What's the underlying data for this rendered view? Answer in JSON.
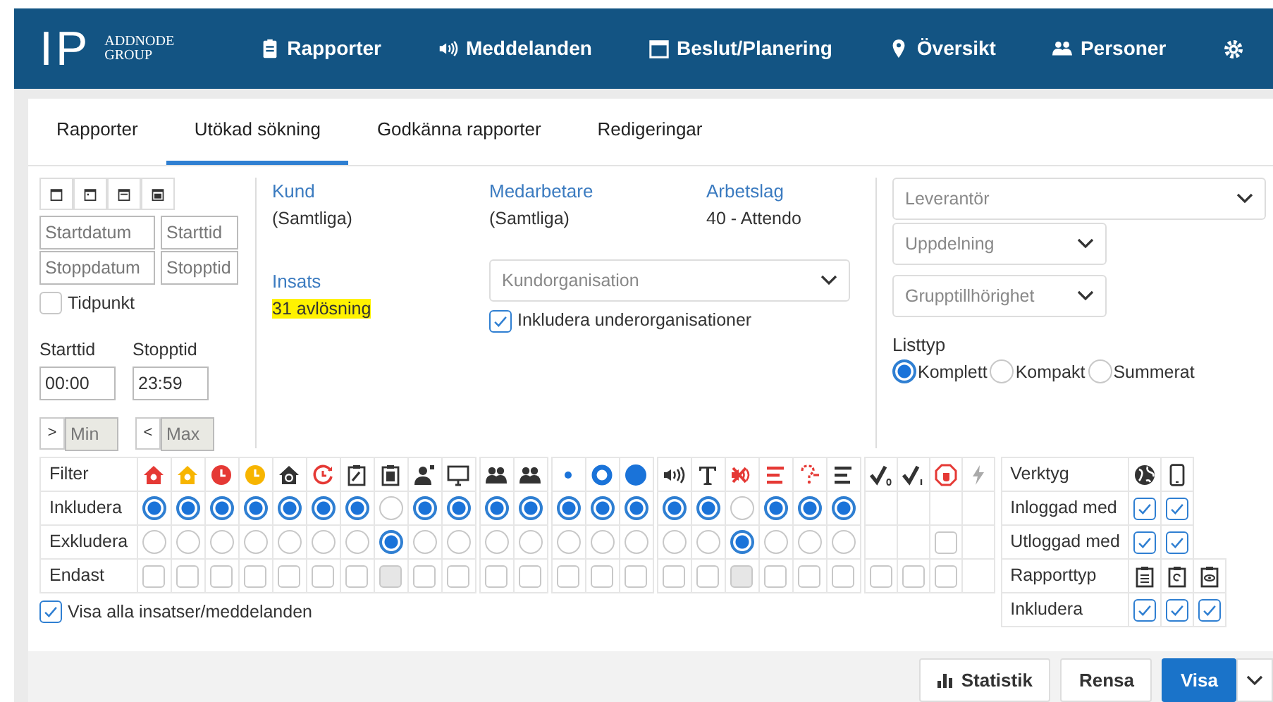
{
  "navbar": {
    "logo_mark": "IP",
    "logo_lines": [
      "ADDNODE",
      "GROUP"
    ],
    "items": [
      {
        "label": "Rapporter"
      },
      {
        "label": "Meddelanden"
      },
      {
        "label": "Beslut/Planering"
      },
      {
        "label": "Översikt"
      },
      {
        "label": "Personer"
      }
    ]
  },
  "tabs": [
    {
      "label": "Rapporter",
      "selected": false
    },
    {
      "label": "Utökad sökning",
      "selected": true
    },
    {
      "label": "Godkänna rapporter",
      "selected": false
    },
    {
      "label": "Redigeringar",
      "selected": false
    }
  ],
  "period": {
    "start_date": {
      "placeholder": "Startdatum"
    },
    "start_time": {
      "placeholder": "Starttid"
    },
    "stop_date": {
      "placeholder": "Stoppdatum"
    },
    "stop_time": {
      "placeholder": "Stopptid"
    },
    "tidpunkt": {
      "label": "Tidpunkt",
      "checked": false
    },
    "time_from": {
      "label": "Starttid",
      "value": "00:00"
    },
    "time_to": {
      "label": "Stopptid",
      "value": "23:59"
    },
    "min": {
      "prefix": ">",
      "placeholder": "Min",
      "disabled": true
    },
    "max": {
      "prefix": "<",
      "placeholder": "Max",
      "disabled": true
    }
  },
  "criteria": [
    {
      "label": "Kund",
      "value": "(Samtliga)"
    },
    {
      "label": "Medarbetare",
      "value": "(Samtliga)"
    },
    {
      "label": "Arbetslag",
      "value": "40 - Attendo"
    }
  ],
  "insats": {
    "label": "Insats",
    "value": "31 avlösning",
    "highlighted": true
  },
  "kundorganisation": {
    "placeholder": "Kundorganisation"
  },
  "include_sub": {
    "label": "Inkludera underorganisationer",
    "checked": true
  },
  "selects": [
    {
      "placeholder": "Leverantör",
      "wide": true
    },
    {
      "placeholder": "Uppdelning",
      "wide": false
    },
    {
      "placeholder": "Grupptillhörighet",
      "wide": false
    }
  ],
  "listtyp": {
    "label": "Listtyp",
    "options": [
      {
        "label": "Komplett",
        "selected": true
      },
      {
        "label": "Kompakt",
        "selected": false
      },
      {
        "label": "Summerat",
        "selected": false
      }
    ]
  },
  "filter": {
    "row_labels": [
      "Filter",
      "Inkludera",
      "Exkludera",
      "Endast"
    ],
    "columns": [
      {
        "group_start": false,
        "cells": [
          {
            "kind": "radio",
            "selected": true
          },
          {
            "kind": "radio",
            "selected": false
          },
          {
            "kind": "checkbox",
            "checked": false,
            "disabled": false
          }
        ]
      },
      {
        "group_start": false,
        "cells": [
          {
            "kind": "radio",
            "selected": true
          },
          {
            "kind": "radio",
            "selected": false
          },
          {
            "kind": "checkbox",
            "checked": false,
            "disabled": false
          }
        ]
      },
      {
        "group_start": false,
        "cells": [
          {
            "kind": "radio",
            "selected": true
          },
          {
            "kind": "radio",
            "selected": false
          },
          {
            "kind": "checkbox",
            "checked": false,
            "disabled": false
          }
        ]
      },
      {
        "group_start": false,
        "cells": [
          {
            "kind": "radio",
            "selected": true
          },
          {
            "kind": "radio",
            "selected": false
          },
          {
            "kind": "checkbox",
            "checked": false,
            "disabled": false
          }
        ]
      },
      {
        "group_start": false,
        "cells": [
          {
            "kind": "radio",
            "selected": true
          },
          {
            "kind": "radio",
            "selected": false
          },
          {
            "kind": "checkbox",
            "checked": false,
            "disabled": false
          }
        ]
      },
      {
        "group_start": false,
        "cells": [
          {
            "kind": "radio",
            "selected": true
          },
          {
            "kind": "radio",
            "selected": false
          },
          {
            "kind": "checkbox",
            "checked": false,
            "disabled": false
          }
        ]
      },
      {
        "group_start": false,
        "cells": [
          {
            "kind": "radio",
            "selected": true
          },
          {
            "kind": "radio",
            "selected": false
          },
          {
            "kind": "checkbox",
            "checked": false,
            "disabled": false
          }
        ]
      },
      {
        "group_start": false,
        "cells": [
          {
            "kind": "radio",
            "selected": false
          },
          {
            "kind": "radio",
            "selected": true
          },
          {
            "kind": "checkbox",
            "checked": false,
            "disabled": true
          }
        ]
      },
      {
        "group_start": false,
        "cells": [
          {
            "kind": "radio",
            "selected": true
          },
          {
            "kind": "radio",
            "selected": false
          },
          {
            "kind": "checkbox",
            "checked": false,
            "disabled": false
          }
        ]
      },
      {
        "group_start": false,
        "cells": [
          {
            "kind": "radio",
            "selected": true
          },
          {
            "kind": "radio",
            "selected": false
          },
          {
            "kind": "checkbox",
            "checked": false,
            "disabled": false
          }
        ]
      },
      {
        "group_start": true,
        "cells": [
          {
            "kind": "radio",
            "selected": true
          },
          {
            "kind": "radio",
            "selected": false
          },
          {
            "kind": "checkbox",
            "checked": false,
            "disabled": false
          }
        ]
      },
      {
        "group_start": false,
        "cells": [
          {
            "kind": "radio",
            "selected": true
          },
          {
            "kind": "radio",
            "selected": false
          },
          {
            "kind": "checkbox",
            "checked": false,
            "disabled": false
          }
        ]
      },
      {
        "group_start": true,
        "cells": [
          {
            "kind": "radio",
            "selected": true
          },
          {
            "kind": "radio",
            "selected": false
          },
          {
            "kind": "checkbox",
            "checked": false,
            "disabled": false
          }
        ]
      },
      {
        "group_start": false,
        "cells": [
          {
            "kind": "radio",
            "selected": true
          },
          {
            "kind": "radio",
            "selected": false
          },
          {
            "kind": "checkbox",
            "checked": false,
            "disabled": false
          }
        ]
      },
      {
        "group_start": false,
        "cells": [
          {
            "kind": "radio",
            "selected": true
          },
          {
            "kind": "radio",
            "selected": false
          },
          {
            "kind": "checkbox",
            "checked": false,
            "disabled": false
          }
        ]
      },
      {
        "group_start": true,
        "cells": [
          {
            "kind": "radio",
            "selected": true
          },
          {
            "kind": "radio",
            "selected": false
          },
          {
            "kind": "checkbox",
            "checked": false,
            "disabled": false
          }
        ]
      },
      {
        "group_start": false,
        "cells": [
          {
            "kind": "radio",
            "selected": true
          },
          {
            "kind": "radio",
            "selected": false
          },
          {
            "kind": "checkbox",
            "checked": false,
            "disabled": false
          }
        ]
      },
      {
        "group_start": false,
        "cells": [
          {
            "kind": "radio",
            "selected": false
          },
          {
            "kind": "radio",
            "selected": true
          },
          {
            "kind": "checkbox",
            "checked": false,
            "disabled": true
          }
        ]
      },
      {
        "group_start": false,
        "cells": [
          {
            "kind": "radio",
            "selected": true
          },
          {
            "kind": "radio",
            "selected": false
          },
          {
            "kind": "checkbox",
            "checked": false,
            "disabled": false
          }
        ]
      },
      {
        "group_start": false,
        "cells": [
          {
            "kind": "radio",
            "selected": true
          },
          {
            "kind": "radio",
            "selected": false
          },
          {
            "kind": "checkbox",
            "checked": false,
            "disabled": false
          }
        ]
      },
      {
        "group_start": false,
        "cells": [
          {
            "kind": "radio",
            "selected": true
          },
          {
            "kind": "radio",
            "selected": false
          },
          {
            "kind": "checkbox",
            "checked": false,
            "disabled": false
          }
        ]
      },
      {
        "group_start": true,
        "cells": [
          {
            "kind": "empty"
          },
          {
            "kind": "empty"
          },
          {
            "kind": "checkbox",
            "checked": false,
            "disabled": false
          }
        ]
      },
      {
        "group_start": false,
        "cells": [
          {
            "kind": "empty"
          },
          {
            "kind": "empty"
          },
          {
            "kind": "checkbox",
            "checked": false,
            "disabled": false
          }
        ]
      },
      {
        "group_start": false,
        "cells": [
          {
            "kind": "empty"
          },
          {
            "kind": "checkbox",
            "checked": false,
            "disabled": false
          },
          {
            "kind": "checkbox",
            "checked": false,
            "disabled": false
          }
        ]
      },
      {
        "group_start": false,
        "cells": [
          {
            "kind": "empty"
          },
          {
            "kind": "empty"
          },
          {
            "kind": "empty"
          }
        ]
      }
    ]
  },
  "tools": [
    {
      "label": "Verktyg",
      "cells": [
        {
          "kind": "icon"
        },
        {
          "kind": "icon"
        }
      ]
    },
    {
      "label": "Inloggad med",
      "cells": [
        {
          "kind": "checkbox",
          "checked": true
        },
        {
          "kind": "checkbox",
          "checked": true
        }
      ]
    },
    {
      "label": "Utloggad med",
      "cells": [
        {
          "kind": "checkbox",
          "checked": true
        },
        {
          "kind": "checkbox",
          "checked": true
        }
      ]
    },
    {
      "label": "Rapporttyp",
      "cells": [
        {
          "kind": "icon"
        },
        {
          "kind": "icon"
        },
        {
          "kind": "icon"
        }
      ]
    },
    {
      "label": "Inkludera",
      "cells": [
        {
          "kind": "checkbox",
          "checked": true
        },
        {
          "kind": "checkbox",
          "checked": true
        },
        {
          "kind": "checkbox",
          "checked": true
        }
      ]
    }
  ],
  "show_all": {
    "label": "Visa alla insatser/meddelanden",
    "checked": true
  },
  "buttons": [
    {
      "label": "Statistik",
      "kind": "chart"
    },
    {
      "label": "Rensa",
      "kind": "plain"
    },
    {
      "label": "Visa",
      "kind": "primary"
    }
  ]
}
